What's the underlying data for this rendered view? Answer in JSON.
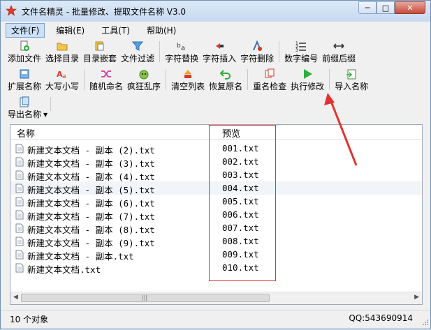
{
  "window": {
    "title": "文件名精灵 - 批量修改、提取文件名称 V3.0",
    "minimize_label": "─",
    "maximize_label": "□",
    "close_label": "✕"
  },
  "menu": [
    "文件(F)",
    "编辑(E)",
    "工具(T)",
    "帮助(H)"
  ],
  "toolbar": {
    "row1": [
      {
        "label": "添加文件",
        "icon": "add-file-icon"
      },
      {
        "label": "选择目录",
        "icon": "folder-icon"
      },
      {
        "label": "目录嵌套",
        "icon": "nested-folder-icon"
      },
      {
        "label": "文件过滤",
        "icon": "filter-icon"
      },
      {
        "label": "字符替换",
        "icon": "replace-text-icon"
      },
      {
        "label": "字符插入",
        "icon": "insert-text-icon"
      },
      {
        "label": "字符删除",
        "icon": "delete-text-icon"
      },
      {
        "label": "数字编号",
        "icon": "numbering-icon"
      },
      {
        "label": "前缀后缀",
        "icon": "prefix-suffix-icon"
      }
    ],
    "row2": [
      {
        "label": "扩展名称",
        "icon": "extension-icon"
      },
      {
        "label": "大写小写",
        "icon": "case-icon"
      },
      {
        "label": "随机命名",
        "icon": "shuffle-icon"
      },
      {
        "label": "疯狂乱序",
        "icon": "crazy-order-icon"
      },
      {
        "label": "清空列表",
        "icon": "clear-list-icon"
      },
      {
        "label": "恢复原名",
        "icon": "undo-icon"
      },
      {
        "label": "重名检查",
        "icon": "duplicate-check-icon"
      },
      {
        "label": "执行修改",
        "icon": "play-icon"
      },
      {
        "label": "导入名称",
        "icon": "import-icon"
      }
    ],
    "row3": [
      {
        "label": "导出名称",
        "icon": "export-icon"
      }
    ]
  },
  "list": {
    "columns": [
      "名称",
      "预览"
    ],
    "rows": [
      {
        "name": "新建文本文档 - 副本 (2).txt",
        "preview": "001.txt"
      },
      {
        "name": "新建文本文档 - 副本 (3).txt",
        "preview": "002.txt"
      },
      {
        "name": "新建文本文档 - 副本 (4).txt",
        "preview": "003.txt"
      },
      {
        "name": "新建文本文档 - 副本 (5).txt",
        "preview": "004.txt"
      },
      {
        "name": "新建文本文档 - 副本 (6).txt",
        "preview": "005.txt"
      },
      {
        "name": "新建文本文档 - 副本 (7).txt",
        "preview": "006.txt"
      },
      {
        "name": "新建文本文档 - 副本 (8).txt",
        "preview": "007.txt"
      },
      {
        "name": "新建文本文档 - 副本 (9).txt",
        "preview": "008.txt"
      },
      {
        "name": "新建文本文档 - 副本.txt",
        "preview": "009.txt"
      },
      {
        "name": "新建文本文档.txt",
        "preview": "010.txt"
      }
    ],
    "selected_row": 3
  },
  "status": {
    "count": "10 个对象",
    "contact": "QQ:543690914"
  },
  "colors": {
    "annotation": "#e2322f",
    "play": "#2fae3b",
    "accent": "#7da2ce"
  }
}
